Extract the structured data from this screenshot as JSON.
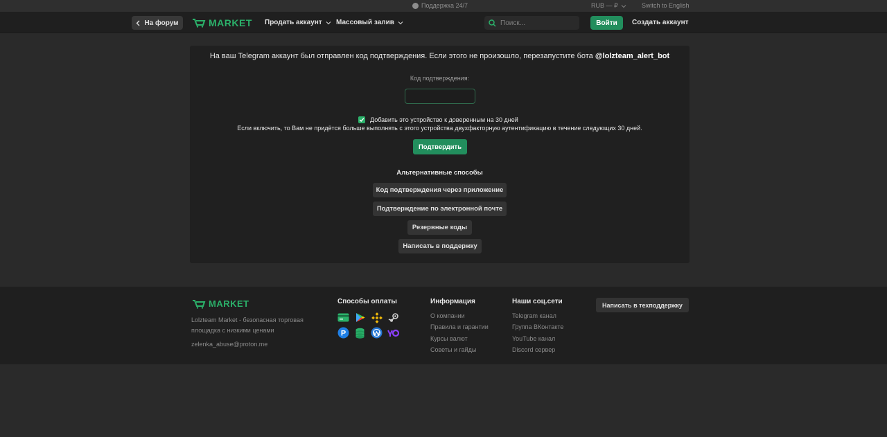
{
  "topbar": {
    "support": "Поддержка 24/7",
    "currency": "RUB — ₽",
    "language": "Switch to English"
  },
  "nav": {
    "back": "На форум",
    "logo": "MARKET",
    "sell": "Продать аккаунт",
    "bulk": "Массовый залив",
    "search_placeholder": "Поиск...",
    "login": "Войти",
    "signup": "Создать аккаунт"
  },
  "twofa": {
    "message_prefix": "На ваш Telegram аккаунт был отправлен код подтверждения. Если этого не произошло, перезапустите бота",
    "bot": "@lolzteam_alert_bot",
    "code_label": "Код подтверждения:",
    "code_value": "",
    "trust_checked": true,
    "trust_label": "Добавить это устройство к доверенным на 30 дней",
    "trust_hint": "Если включить, то Вам не придётся больше выполнять с этого устройства двухфакторную аутентификацию в течение следующих 30 дней.",
    "confirm": "Подтвердить",
    "alt_title": "Альтернативные способы",
    "alt_buttons": [
      "Код подтверждения через приложение",
      "Подтверждение по электронной почте",
      "Резервные коды",
      "Написать в поддержку"
    ]
  },
  "footer": {
    "logo": "MARKET",
    "description": "Lolzteam Market - безопасная торговая площадка с низкими ценами",
    "email": "zelenka_abuse@proton.me",
    "payments_title": "Способы оплаты",
    "payment_icons": [
      "card-icon",
      "google-play-icon",
      "binance-icon",
      "steam-icon",
      "paypal-icon",
      "crypto-stack-icon",
      "webmoney-icon",
      "yoomoney-icon"
    ],
    "info_title": "Информация",
    "info_links": [
      "О компании",
      "Правила и гарантии",
      "Курсы валют",
      "Советы и гайды"
    ],
    "social_title": "Наши соц.сети",
    "social_links": [
      "Telegram канал",
      "Группа ВКонтакте",
      "YouTube канал",
      "Discord сервер"
    ],
    "tech_support": "Написать в техподдержку"
  },
  "colors": {
    "accent": "#228e5d",
    "logo_green": "#2bb16a",
    "background": "#2a2a2a",
    "panel": "#202020"
  }
}
